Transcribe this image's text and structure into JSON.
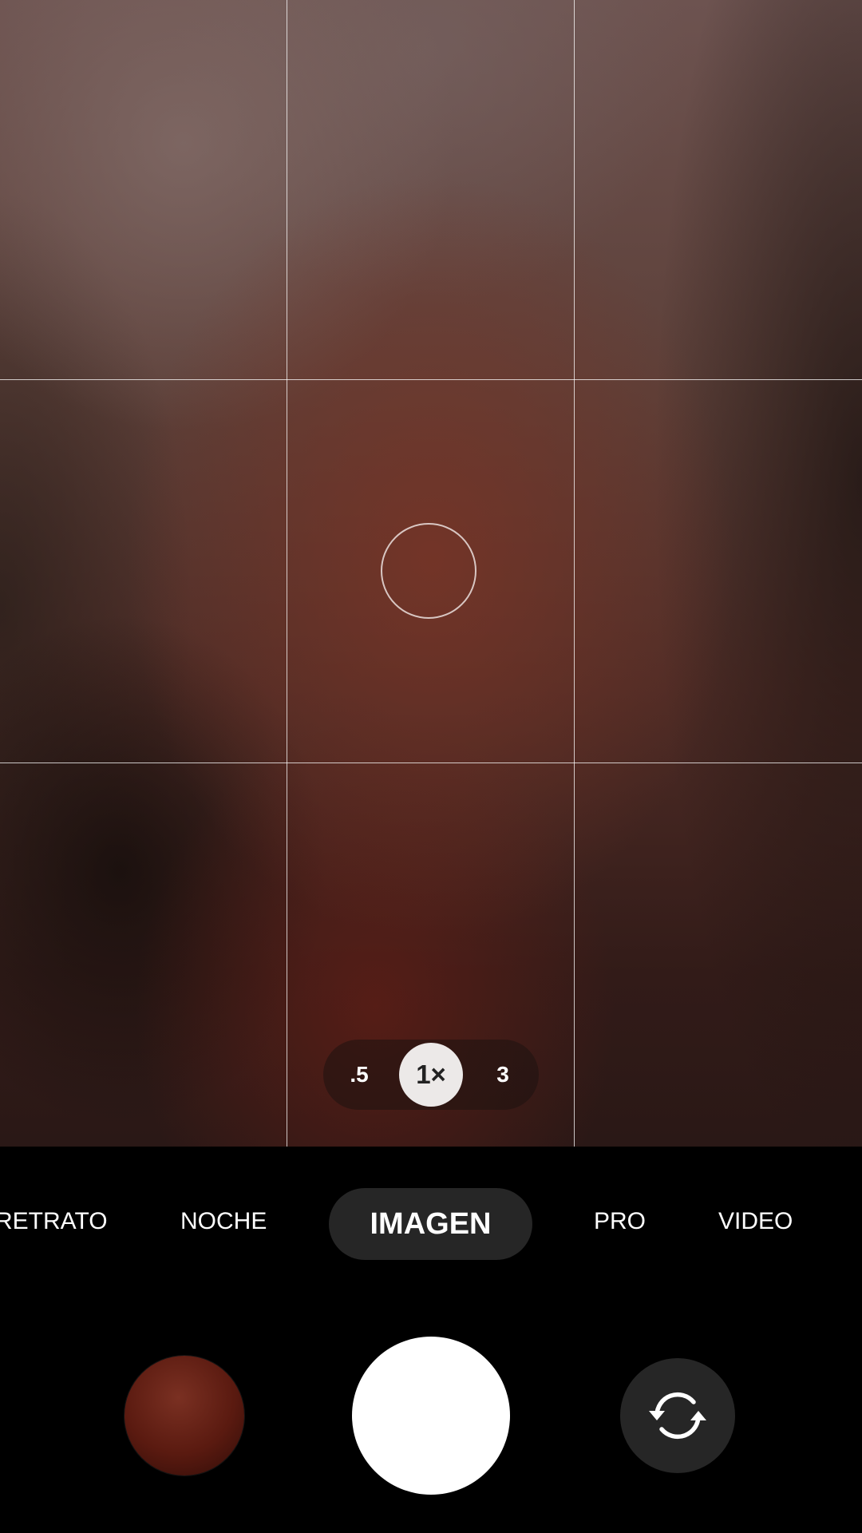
{
  "zoom": {
    "options": [
      ".5",
      "1×",
      "3"
    ],
    "selected": "1×"
  },
  "modes": {
    "items": [
      "RETRATO",
      "NOCHE",
      "IMAGEN",
      "PRO",
      "VIDEO"
    ],
    "selected": "IMAGEN"
  },
  "controls": {
    "gallery_icon": "gallery-thumbnail",
    "shutter_icon": "shutter-button",
    "flip_icon": "switch-camera-icon"
  },
  "colors": {
    "background": "#000000",
    "active_pill": "#262626",
    "shutter": "#ffffff",
    "zoom_active": "#ece9e8"
  }
}
